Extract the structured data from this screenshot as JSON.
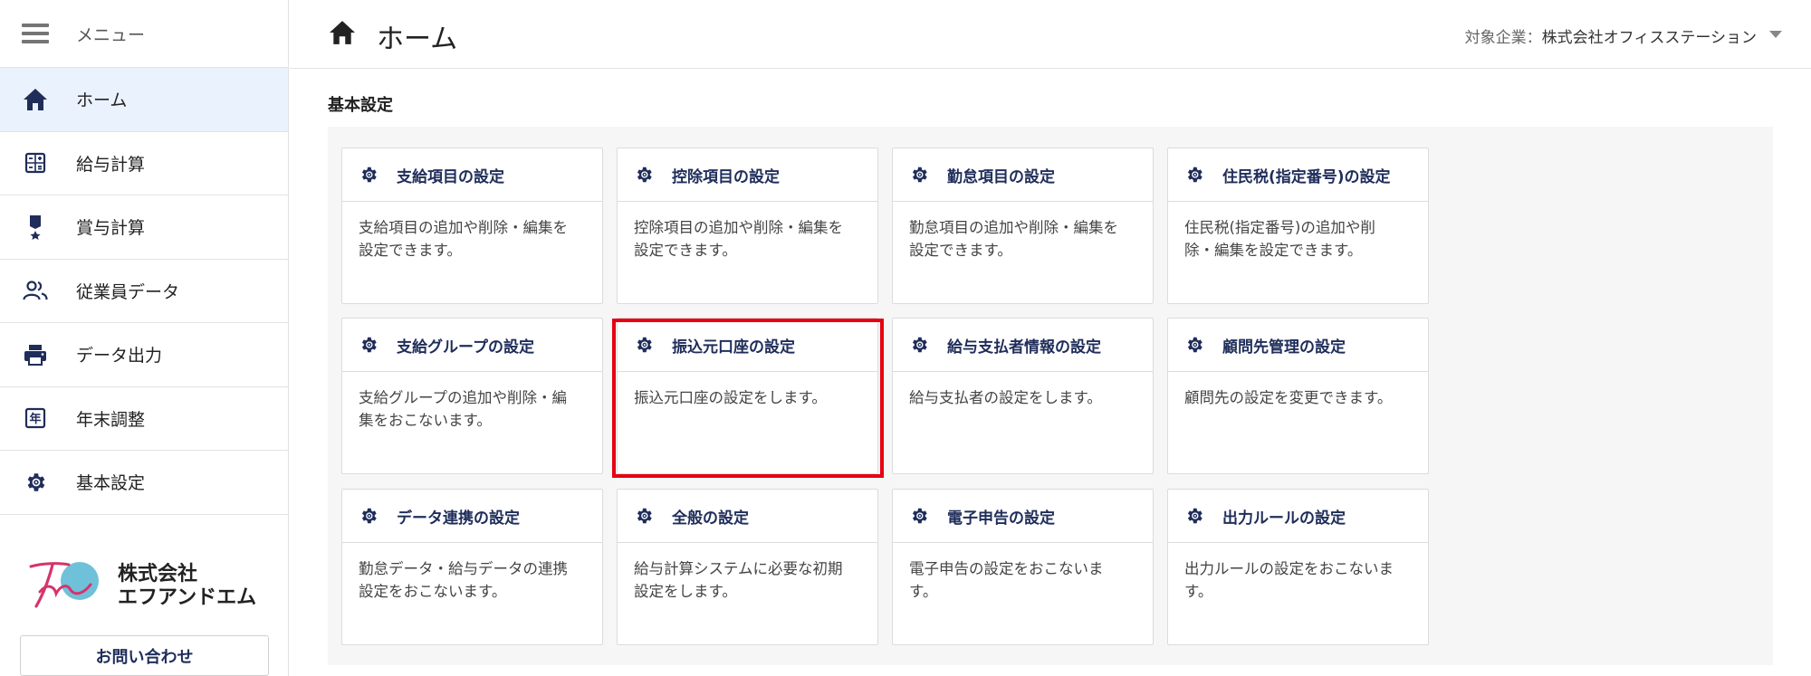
{
  "sidebar": {
    "menu_label": "メニュー",
    "items": [
      {
        "id": "home",
        "label": "ホーム",
        "icon": "home-icon",
        "active": true
      },
      {
        "id": "payroll",
        "label": "給与計算",
        "icon": "calculator-icon",
        "active": false
      },
      {
        "id": "bonus",
        "label": "賞与計算",
        "icon": "award-icon",
        "active": false
      },
      {
        "id": "employees",
        "label": "従業員データ",
        "icon": "people-icon",
        "active": false
      },
      {
        "id": "export",
        "label": "データ出力",
        "icon": "printer-icon",
        "active": false
      },
      {
        "id": "yearend",
        "label": "年末調整",
        "icon": "calendar-year-icon",
        "active": false
      },
      {
        "id": "settings",
        "label": "基本設定",
        "icon": "gear-icon",
        "active": false
      }
    ],
    "logo_line1": "株式会社",
    "logo_line2": "エフアンドエム",
    "contact_label": "お問い合わせ"
  },
  "header": {
    "title": "ホーム",
    "company_label": "対象企業：",
    "company_name": "株式会社オフィスステーション"
  },
  "main": {
    "section_title": "基本設定",
    "cards": [
      {
        "title": "支給項目の設定",
        "desc_lines": [
          "支給項目の追加や削除・編集を",
          "設定できます。"
        ]
      },
      {
        "title": "控除項目の設定",
        "desc_lines": [
          "控除項目の追加や削除・編集を",
          "設定できます。"
        ]
      },
      {
        "title": "勤怠項目の設定",
        "desc_lines": [
          "勤怠項目の追加や削除・編集を",
          "設定できます。"
        ]
      },
      {
        "title": "住民税(指定番号)の設定",
        "desc_lines": [
          "住民税(指定番号)の追加や削",
          "除・編集を設定できます。"
        ]
      },
      {
        "title": "支給グループの設定",
        "desc_lines": [
          "支給グループの追加や削除・編",
          "集をおこないます。"
        ]
      },
      {
        "title": "振込元口座の設定",
        "desc_lines": [
          "振込元口座の設定をします。"
        ]
      },
      {
        "title": "給与支払者情報の設定",
        "desc_lines": [
          "給与支払者の設定をします。"
        ]
      },
      {
        "title": "顧問先管理の設定",
        "desc_lines": [
          "顧問先の設定を変更できます。"
        ]
      },
      {
        "title": "データ連携の設定",
        "desc_lines": [
          "勤怠データ・給与データの連携",
          "設定をおこないます。"
        ]
      },
      {
        "title": "全般の設定",
        "desc_lines": [
          "給与計算システムに必要な初期",
          "設定をします。"
        ]
      },
      {
        "title": "電子申告の設定",
        "desc_lines": [
          "電子申告の設定をおこないま",
          "す。"
        ]
      },
      {
        "title": "出力ルールの設定",
        "desc_lines": [
          "出力ルールの設定をおこないま",
          "す。"
        ]
      }
    ],
    "highlighted_card": "振込元口座の設定"
  },
  "colors": {
    "accent_navy": "#1f2d5a",
    "active_bg": "#eaf2fd",
    "highlight_red": "#e60012"
  }
}
